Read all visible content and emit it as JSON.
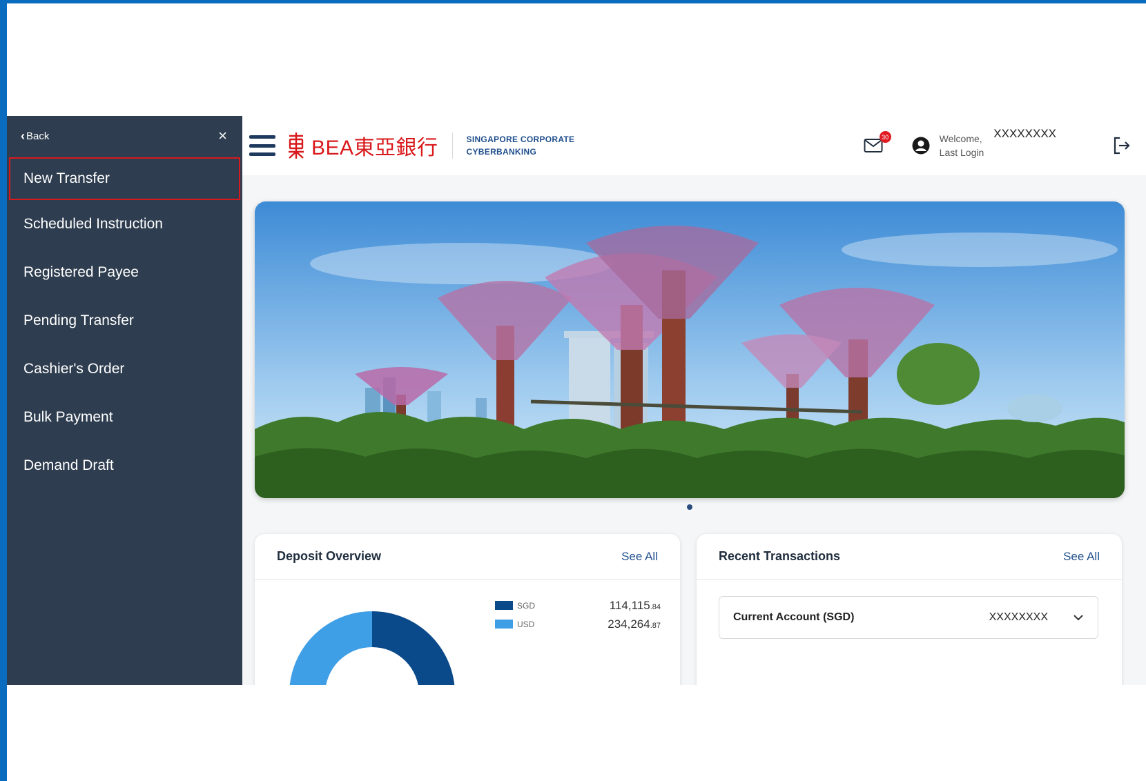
{
  "sidebar": {
    "back_label": "Back",
    "close_glyph": "×",
    "items": [
      {
        "label": "New Transfer"
      },
      {
        "label": "Scheduled Instruction"
      },
      {
        "label": "Registered Payee"
      },
      {
        "label": "Pending Transfer"
      },
      {
        "label": "Cashier's Order"
      },
      {
        "label": "Bulk Payment"
      },
      {
        "label": "Demand Draft"
      }
    ]
  },
  "header": {
    "logo_text": "BEA東亞銀行",
    "logo_sub_line1": "SINGAPORE CORPORATE",
    "logo_sub_line2": "CYBERBANKING",
    "mail_badge": "30",
    "welcome_line1": "Welcome,",
    "welcome_line2": "Last Login",
    "user_name": "XXXXXXXX"
  },
  "deposit": {
    "title": "Deposit Overview",
    "see_all": "See All",
    "legend": [
      {
        "currency": "SGD",
        "amount_main": "114,115",
        "amount_cents": ".84",
        "color": "#0b4a8a"
      },
      {
        "currency": "USD",
        "amount_main": "234,264",
        "amount_cents": ".87",
        "color": "#3f9fe6"
      }
    ]
  },
  "recent": {
    "title": "Recent Transactions",
    "see_all": "See All",
    "account_label": "Current Account (SGD)",
    "account_number": "XXXXXXXX"
  },
  "colors": {
    "brand_red": "#d9191c",
    "sidebar_bg": "#2e3d4f",
    "link_blue": "#1f4e8c"
  }
}
